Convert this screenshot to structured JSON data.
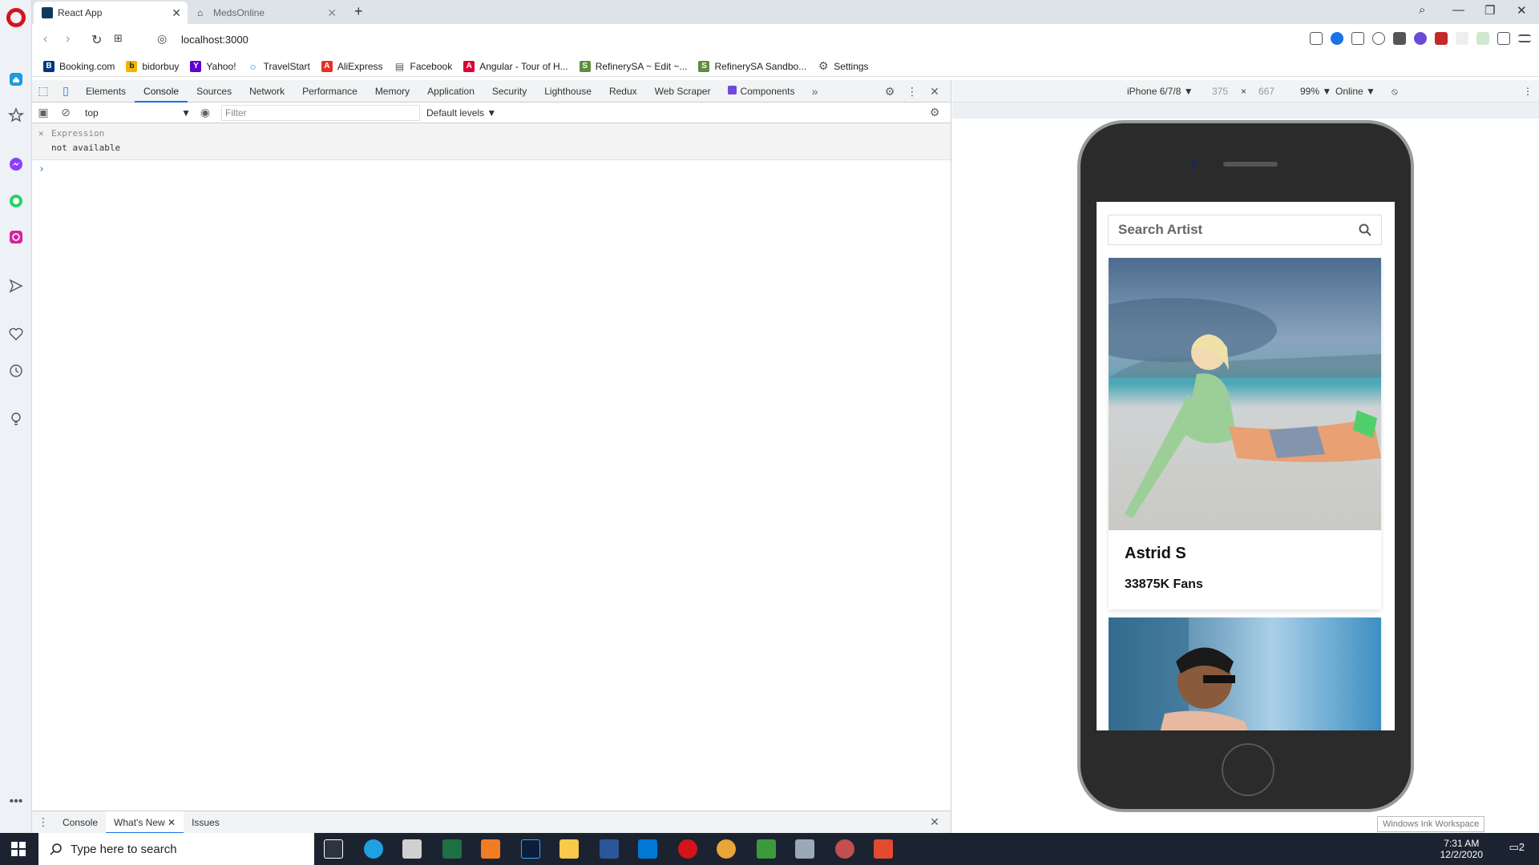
{
  "browser": {
    "tabs": [
      {
        "label": "React App"
      },
      {
        "label": "MedsOnline"
      }
    ],
    "url": "localhost:3000",
    "bookmarks": [
      {
        "label": "Booking.com",
        "icon": "B",
        "color": "#003580"
      },
      {
        "label": "bidorbuy",
        "icon": "b",
        "color": "#f4b400"
      },
      {
        "label": "Yahoo!",
        "icon": "Y",
        "color": "#5f01d1"
      },
      {
        "label": "TravelStart",
        "icon": "○",
        "color": "#1a9be8"
      },
      {
        "label": "AliExpress",
        "icon": "A",
        "color": "#e43225"
      },
      {
        "label": "Facebook",
        "icon": "▤",
        "color": "#555555"
      },
      {
        "label": "Angular - Tour of H...",
        "icon": "A",
        "color": "#dd0031"
      },
      {
        "label": "RefinerySA ~ Edit ~...",
        "icon": "S",
        "color": "#5e8e3e"
      },
      {
        "label": "RefinerySA Sandbo...",
        "icon": "S",
        "color": "#5e8e3e"
      },
      {
        "label": "Settings",
        "icon": "⚙",
        "color": "#666666"
      }
    ]
  },
  "devtools": {
    "tabs": [
      "Elements",
      "Console",
      "Sources",
      "Network",
      "Performance",
      "Memory",
      "Application",
      "Security",
      "Lighthouse",
      "Redux",
      "Web Scraper",
      "Components"
    ],
    "active_tab": "Console",
    "context": "top",
    "filter_placeholder": "Filter",
    "levels": "Default levels ▼",
    "expression_title": "Expression",
    "expression_value": "not available",
    "drawer_tabs": [
      "Console",
      "What's New",
      "Issues"
    ]
  },
  "device": {
    "name": "iPhone 6/7/8 ▼",
    "width": "375",
    "times": "×",
    "height": "667",
    "zoom": "99% ▼",
    "network": "Online ▼"
  },
  "app": {
    "search_placeholder": "Search Artist",
    "artists": [
      {
        "name": "Astrid S",
        "fans": "33875K Fans"
      }
    ]
  },
  "tooltip": "Windows Ink Workspace",
  "taskbar": {
    "search_placeholder": "Type here to search",
    "time": "7:31 AM",
    "date": "12/2/2020",
    "notif_count": "2"
  }
}
